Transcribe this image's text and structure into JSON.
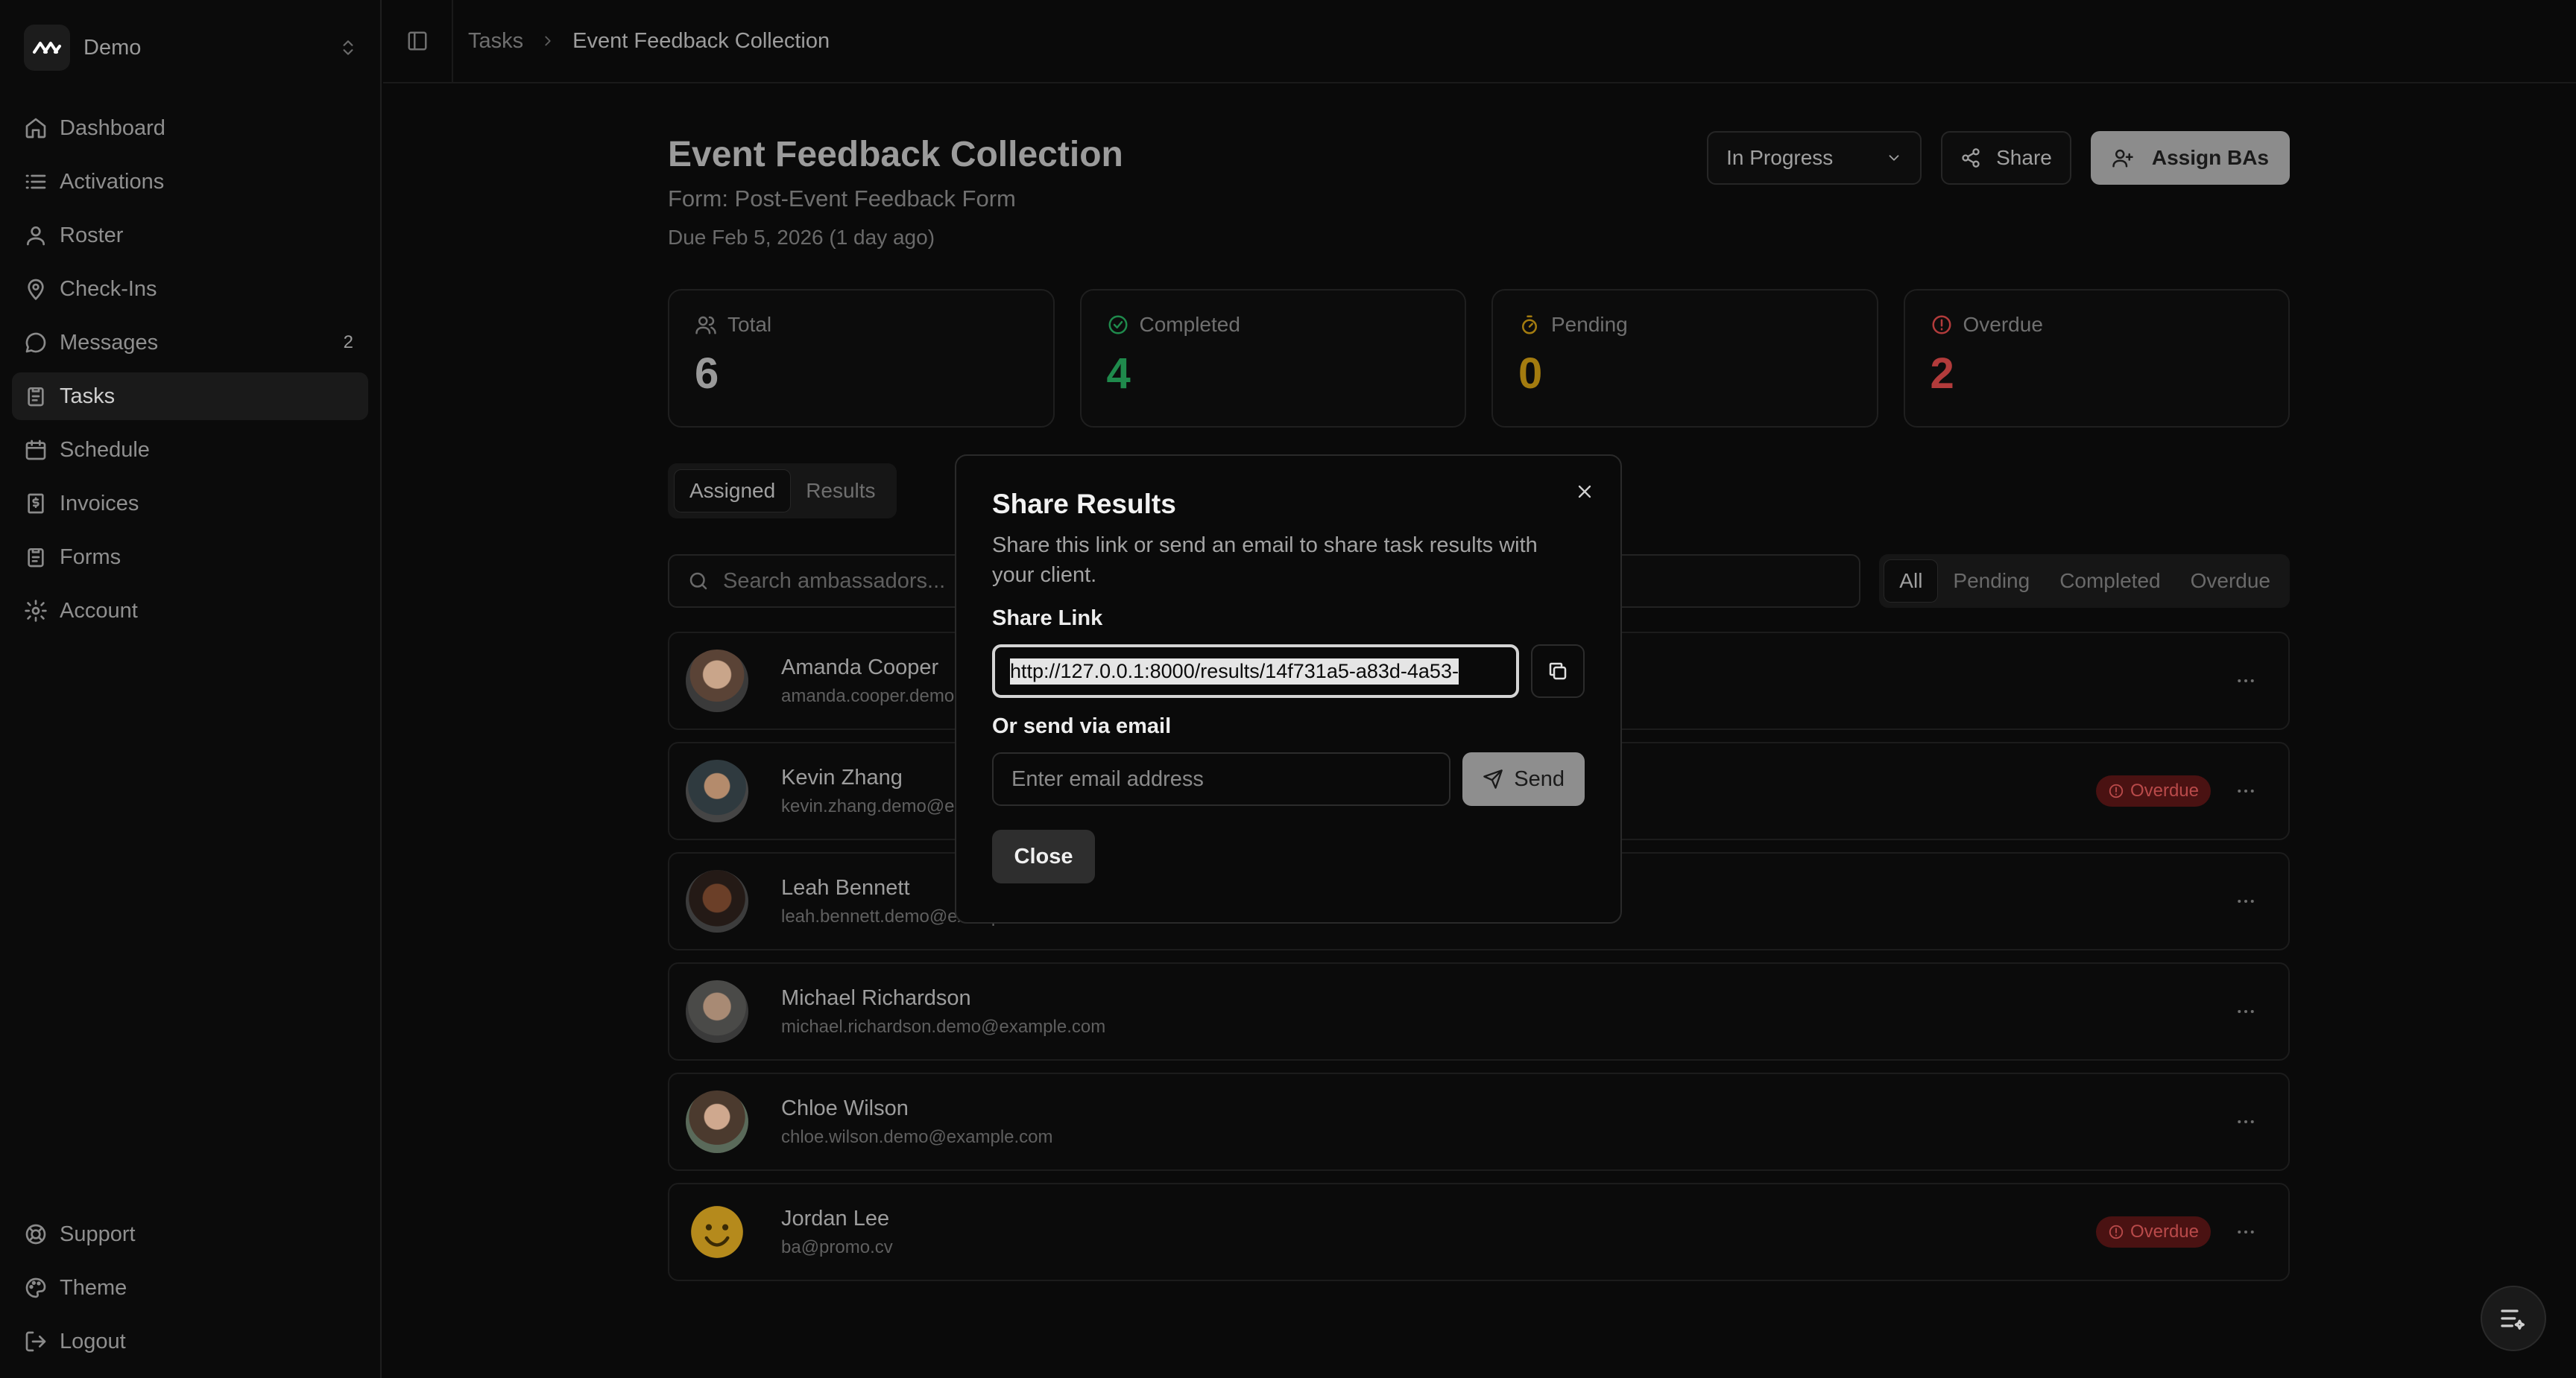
{
  "workspace": {
    "name": "Demo"
  },
  "nav": {
    "items": [
      {
        "label": "Dashboard",
        "icon": "home-icon"
      },
      {
        "label": "Activations",
        "icon": "list-icon"
      },
      {
        "label": "Roster",
        "icon": "user-icon"
      },
      {
        "label": "Check-Ins",
        "icon": "map-pin-icon"
      },
      {
        "label": "Messages",
        "icon": "message-icon",
        "badge": "2"
      },
      {
        "label": "Tasks",
        "icon": "clipboard-icon",
        "active": true
      },
      {
        "label": "Schedule",
        "icon": "calendar-icon"
      },
      {
        "label": "Invoices",
        "icon": "receipt-icon"
      },
      {
        "label": "Forms",
        "icon": "clipboard-icon"
      },
      {
        "label": "Account",
        "icon": "gear-icon"
      }
    ],
    "bottom": [
      {
        "label": "Support",
        "icon": "lifebuoy-icon"
      },
      {
        "label": "Theme",
        "icon": "palette-icon"
      },
      {
        "label": "Logout",
        "icon": "logout-icon"
      }
    ]
  },
  "breadcrumb": {
    "parent": "Tasks",
    "current": "Event Feedback Collection"
  },
  "page": {
    "title": "Event Feedback Collection",
    "form": "Form: Post-Event Feedback Form",
    "due": "Due Feb 5, 2026 (1 day ago)",
    "status": "In Progress",
    "share_label": "Share",
    "assign_label": "Assign BAs"
  },
  "stats": [
    {
      "label": "Total",
      "value": "6",
      "color": "#9a9a9a",
      "icon": "users-icon"
    },
    {
      "label": "Completed",
      "value": "4",
      "color": "#1f8a4c",
      "icon": "check-circle-icon"
    },
    {
      "label": "Pending",
      "value": "0",
      "color": "#a37b0f",
      "icon": "timer-icon"
    },
    {
      "label": "Overdue",
      "value": "2",
      "color": "#b23b3b",
      "icon": "alert-circle-icon"
    }
  ],
  "tabs": {
    "assigned": "Assigned",
    "results": "Results"
  },
  "search": {
    "placeholder": "Search ambassadors..."
  },
  "filters": {
    "all": "All",
    "pending": "Pending",
    "completed": "Completed",
    "overdue": "Overdue"
  },
  "ambassadors": [
    {
      "name": "Amanda Cooper",
      "email": "amanda.cooper.demo@example.com",
      "overdue": false
    },
    {
      "name": "Kevin Zhang",
      "email": "kevin.zhang.demo@example.com",
      "overdue": true
    },
    {
      "name": "Leah Bennett",
      "email": "leah.bennett.demo@example.com",
      "overdue": false
    },
    {
      "name": "Michael Richardson",
      "email": "michael.richardson.demo@example.com",
      "overdue": false
    },
    {
      "name": "Chloe Wilson",
      "email": "chloe.wilson.demo@example.com",
      "overdue": false
    },
    {
      "name": "Jordan Lee",
      "email": "ba@promo.cv",
      "overdue": true
    }
  ],
  "overdue_label": "Overdue",
  "modal": {
    "title": "Share Results",
    "description": "Share this link or send an email to share task results with your client.",
    "link_label": "Share Link",
    "link_value": "http://127.0.0.1:8000/results/14f731a5-a83d-4a53-",
    "email_label": "Or send via email",
    "email_placeholder": "Enter email address",
    "send_label": "Send",
    "close_label": "Close"
  }
}
